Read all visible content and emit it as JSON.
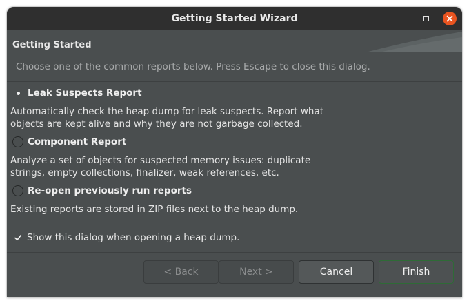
{
  "window": {
    "title": "Getting Started Wizard"
  },
  "page": {
    "title": "Getting Started",
    "description": "Choose one of the common reports below. Press Escape to close this dialog."
  },
  "options": [
    {
      "label": "Leak Suspects Report",
      "selected": true,
      "description_lines": [
        "Automatically check the heap dump for leak suspects. Report what",
        "objects are kept alive and why they are not garbage collected."
      ]
    },
    {
      "label": "Component Report",
      "selected": false,
      "description_lines": [
        "Analyze a set of objects for suspected memory issues: duplicate",
        "strings, empty collections, finalizer, weak references, etc."
      ]
    },
    {
      "label": "Re-open previously run reports",
      "selected": false,
      "description_lines": [
        "Existing reports are stored in ZIP files next to the heap dump."
      ]
    }
  ],
  "show_dialog_checkbox": {
    "label": "Show this dialog when opening a heap dump.",
    "checked": true
  },
  "buttons": {
    "back": "< Back",
    "next": "Next >",
    "cancel": "Cancel",
    "finish": "Finish"
  },
  "colors": {
    "window_bg": "#4a4e4f",
    "titlebar_bg": "#2f2f2f",
    "close_button": "#e95420",
    "default_button_border": "#2e6b36"
  }
}
